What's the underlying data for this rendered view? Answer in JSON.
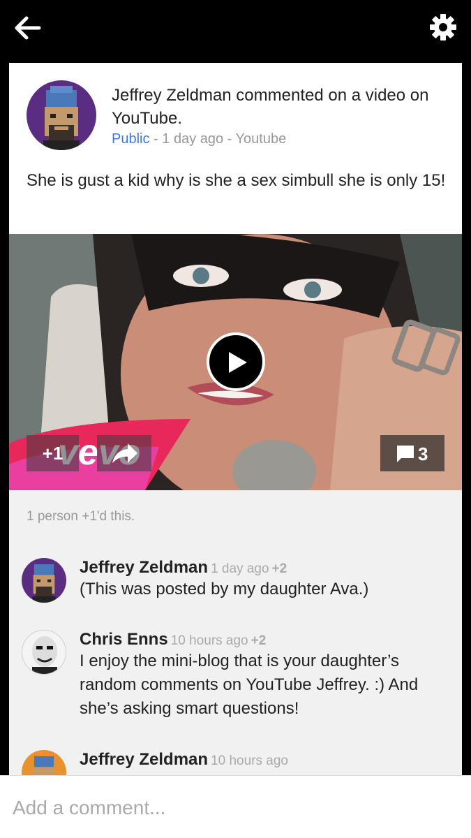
{
  "topbar": {
    "back_icon": "back-arrow-icon",
    "settings_icon": "gear-icon"
  },
  "post": {
    "author_line": "Jeffrey Zeldman commented on a video on YouTube.",
    "visibility": "Public",
    "separator1": " - ",
    "time": "1 day ago",
    "separator2": " - ",
    "source": "Youtube",
    "body": "She is gust a kid why is she a sex simbull she is only 15!"
  },
  "video": {
    "logo": "vevo",
    "plus_one_label": "+1",
    "comment_count": "3"
  },
  "comments_section": {
    "plus_ones_text": "1 person +1'd this.",
    "comments": [
      {
        "author": "Jeffrey Zeldman",
        "time": "1 day ago",
        "plus": "+2",
        "text": "(This was posted by my daughter Ava.)"
      },
      {
        "author": "Chris Enns",
        "time": "10 hours ago",
        "plus": "+2",
        "text": "I enjoy the mini-blog that is your daughter’s random comments on YouTube Jeffrey. :) And she’s asking smart questions!"
      },
      {
        "author": "Jeffrey Zeldman",
        "time": "10 hours ago",
        "plus": "",
        "text": ""
      }
    ]
  },
  "composer": {
    "placeholder": "Add a comment..."
  },
  "colors": {
    "link_blue": "#3b7ad9",
    "vevo_pink": "#e8275a"
  }
}
